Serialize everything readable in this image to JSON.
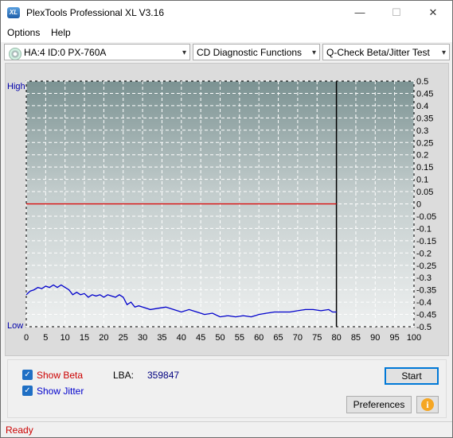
{
  "window": {
    "title": "PlexTools Professional XL V3.16",
    "app_icon_text": "XL",
    "minimize": "—",
    "maximize": "☐",
    "close": "✕"
  },
  "menu": {
    "items": [
      {
        "label": "Options"
      },
      {
        "label": "Help"
      }
    ]
  },
  "toolbar": {
    "drive": "HA:4 ID:0  PX-760A",
    "function": "CD Diagnostic Functions",
    "test": "Q-Check Beta/Jitter Test",
    "arrow": "▾"
  },
  "chart_data": {
    "type": "line",
    "title": "",
    "left_axis_labels": {
      "high": "High",
      "low": "Low"
    },
    "xlim": [
      0,
      100
    ],
    "x_ticks": [
      0,
      5,
      10,
      15,
      20,
      25,
      30,
      35,
      40,
      45,
      50,
      55,
      60,
      65,
      70,
      75,
      80,
      85,
      90,
      95,
      100
    ],
    "ylim": [
      -0.5,
      0.5
    ],
    "y_ticks": [
      "0.5",
      "0.45",
      "0.4",
      "0.35",
      "0.3",
      "0.25",
      "0.2",
      "0.15",
      "0.1",
      "0.05",
      "0",
      "-0.05",
      "-0.1",
      "-0.15",
      "-0.2",
      "-0.25",
      "-0.3",
      "-0.35",
      "-0.4",
      "-0.45",
      "-0.5"
    ],
    "y_tick_values": [
      0.5,
      0.45,
      0.4,
      0.35,
      0.3,
      0.25,
      0.2,
      0.15,
      0.1,
      0.05,
      0,
      -0.05,
      -0.1,
      -0.15,
      -0.2,
      -0.25,
      -0.3,
      -0.35,
      -0.4,
      -0.45,
      -0.5
    ],
    "grid": true,
    "test_end_x": 80,
    "series": [
      {
        "name": "Beta",
        "color": "#dd0000",
        "x": [
          0,
          5,
          10,
          20,
          30,
          40,
          50,
          60,
          70,
          75,
          80
        ],
        "y": [
          0.0,
          0.0,
          0.0,
          0.0,
          0.0,
          0.0,
          0.0,
          0.0,
          0.0,
          0.0,
          0.0
        ]
      },
      {
        "name": "Jitter",
        "color": "#0000cc",
        "x": [
          0,
          1,
          2,
          3,
          4,
          5,
          6,
          7,
          8,
          9,
          10,
          11,
          12,
          13,
          14,
          15,
          16,
          17,
          18,
          19,
          20,
          21,
          22,
          23,
          24,
          25,
          26,
          27,
          28,
          29,
          30,
          32,
          34,
          36,
          38,
          40,
          42,
          44,
          46,
          48,
          50,
          52,
          54,
          56,
          58,
          60,
          62,
          64,
          66,
          68,
          70,
          72,
          74,
          76,
          78,
          79,
          80
        ],
        "y": [
          -0.37,
          -0.355,
          -0.35,
          -0.34,
          -0.345,
          -0.335,
          -0.34,
          -0.33,
          -0.34,
          -0.33,
          -0.34,
          -0.35,
          -0.37,
          -0.36,
          -0.37,
          -0.365,
          -0.38,
          -0.37,
          -0.375,
          -0.37,
          -0.38,
          -0.37,
          -0.375,
          -0.38,
          -0.37,
          -0.38,
          -0.41,
          -0.4,
          -0.42,
          -0.415,
          -0.42,
          -0.43,
          -0.425,
          -0.42,
          -0.43,
          -0.44,
          -0.43,
          -0.44,
          -0.45,
          -0.445,
          -0.46,
          -0.455,
          -0.46,
          -0.455,
          -0.46,
          -0.45,
          -0.445,
          -0.44,
          -0.44,
          -0.44,
          -0.435,
          -0.43,
          -0.43,
          -0.435,
          -0.43,
          -0.44,
          -0.44
        ]
      }
    ]
  },
  "controls": {
    "show_beta": "Show Beta",
    "show_jitter": "Show Jitter",
    "checkmark": "✓",
    "lba_label": "LBA:",
    "lba_value": "359847",
    "start": "Start",
    "preferences": "Preferences",
    "info_icon_glyph": "i",
    "beta_color": "#cc0000",
    "jitter_color": "#0000cc"
  },
  "status": {
    "text": "Ready",
    "color": "#cc0000"
  }
}
